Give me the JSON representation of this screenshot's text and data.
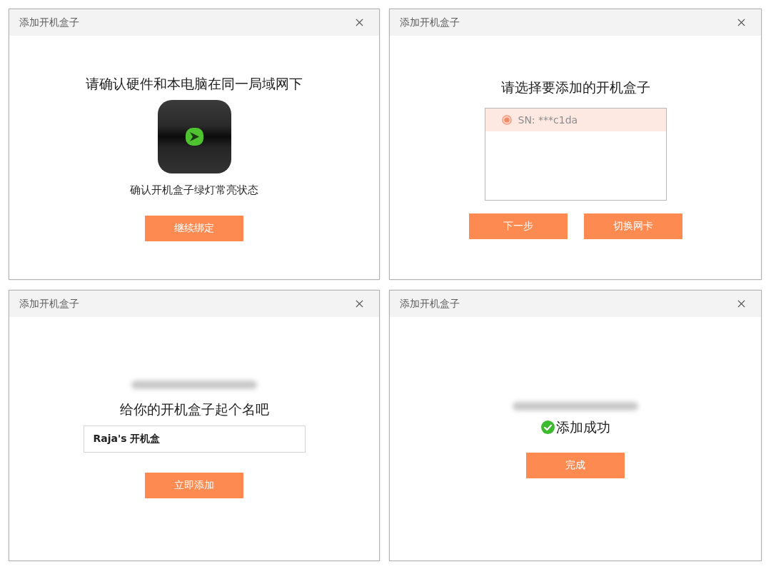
{
  "dialogs": [
    {
      "kind": "confirm",
      "title": "添加开机盒子",
      "heading": "请确认硬件和本电脑在同一局域网下",
      "hint": "确认开机盒子绿灯常亮状态",
      "buttons": [
        "继续绑定"
      ]
    },
    {
      "kind": "select",
      "title": "添加开机盒子",
      "heading": "请选择要添加的开机盒子",
      "devices": [
        {
          "label": "SN: ***c1da",
          "selected": true
        }
      ],
      "buttons": [
        "下一步",
        "切换网卡"
      ]
    },
    {
      "kind": "name",
      "title": "添加开机盒子",
      "heading": "给你的开机盒子起个名吧",
      "name_field": {
        "value": "Raja's 开机盒"
      },
      "buttons": [
        "立即添加"
      ]
    },
    {
      "kind": "success",
      "title": "添加开机盒子",
      "heading": "添加成功",
      "buttons": [
        "完成"
      ]
    }
  ]
}
